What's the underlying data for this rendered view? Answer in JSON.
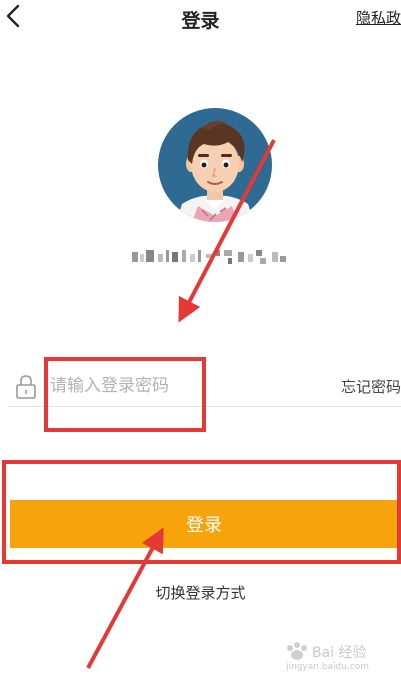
{
  "header": {
    "title": "登录",
    "privacy_label": "隐私政"
  },
  "password": {
    "placeholder": "请输入登录密码",
    "forgot_label": "忘记密码"
  },
  "login_button": {
    "label": "登录"
  },
  "switch_method": {
    "label": "切换登录方式"
  },
  "watermark": {
    "text": "Bai 经验",
    "url": "jingyan.baidu.com"
  },
  "colors": {
    "primary": "#f7a40c",
    "annotation": "#e53935",
    "avatar_bg": "#2e6a91"
  },
  "icons": {
    "back": "chevron-left-icon",
    "lock": "lock-icon"
  }
}
